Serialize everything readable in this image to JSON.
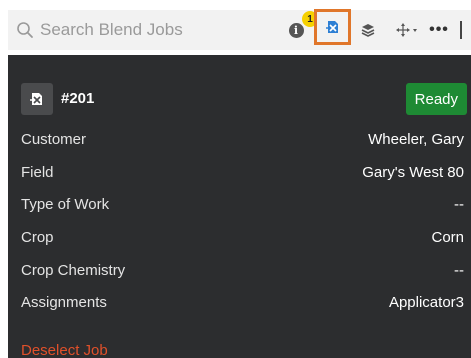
{
  "search": {
    "placeholder": "Search Blend Jobs",
    "icon": "search-icon"
  },
  "toolbar": {
    "info_icon": "info-icon",
    "info_badge": "1",
    "blend_icon": "blend-job-icon",
    "layers_icon": "layers-icon",
    "move_icon": "move-icon",
    "more_label": "•••",
    "highlight_color": "#e0762a"
  },
  "job": {
    "number": "#201",
    "status": "Ready",
    "status_color": "#1e8a34"
  },
  "details": [
    {
      "label": "Customer",
      "value": "Wheeler, Gary"
    },
    {
      "label": "Field",
      "value": "Gary's West 80"
    },
    {
      "label": "Type of Work",
      "value": "--"
    },
    {
      "label": "Crop",
      "value": "Corn"
    },
    {
      "label": "Crop Chemistry",
      "value": "--"
    },
    {
      "label": "Assignments",
      "value": "Applicator3"
    }
  ],
  "actions": {
    "deselect_label": "Deselect Job"
  },
  "colors": {
    "panel_bg": "#2c2d2f",
    "deselect": "#e0502a"
  }
}
